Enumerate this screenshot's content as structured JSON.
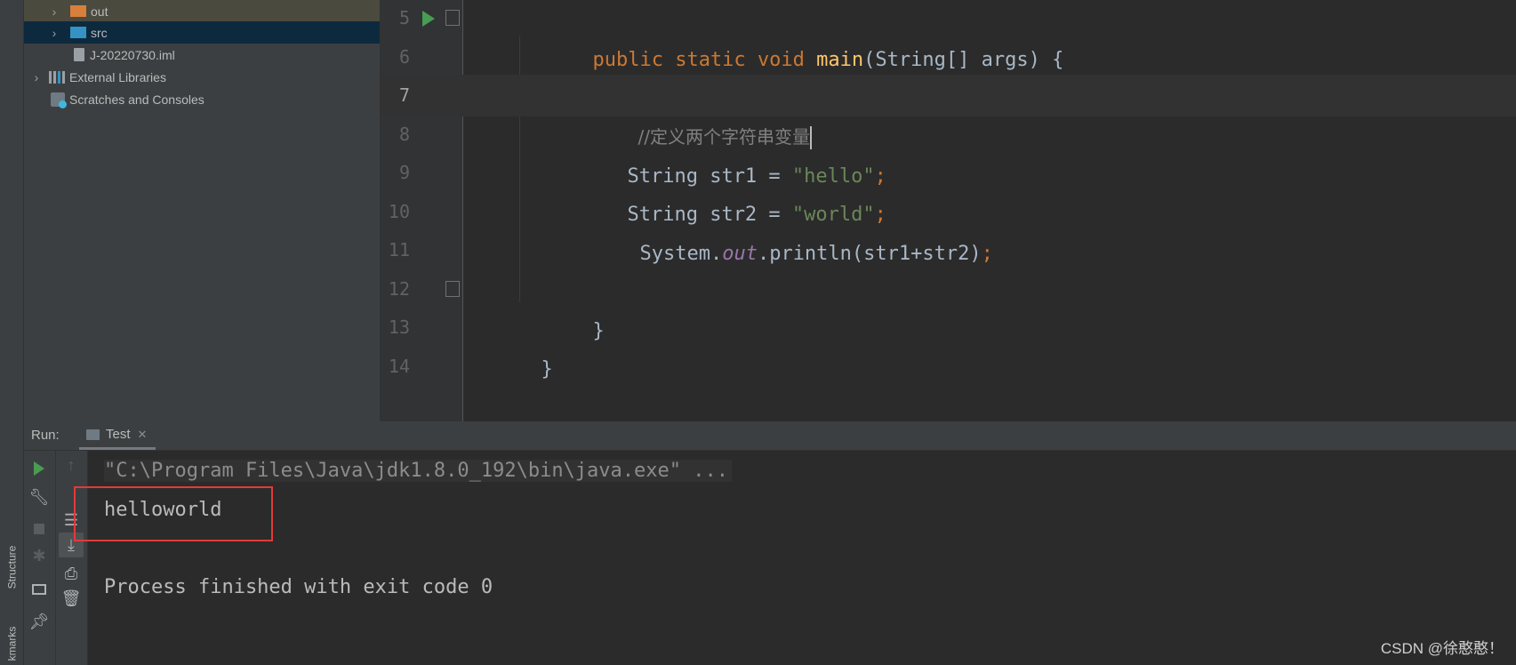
{
  "left_strip": {
    "tabs": [
      "Structure",
      "kmarks"
    ]
  },
  "project_tree": {
    "items": [
      {
        "label": "out",
        "icon": "folder-icon",
        "color": "#d97f3c",
        "state": "collapsed"
      },
      {
        "label": "src",
        "icon": "folder-icon",
        "color": "#3592c4",
        "state": "collapsed"
      },
      {
        "label": "J-20220730.iml",
        "icon": "iml-file-icon"
      },
      {
        "label": "External Libraries",
        "icon": "libraries-icon",
        "state": "collapsed"
      },
      {
        "label": "Scratches and Consoles",
        "icon": "scratches-icon"
      }
    ]
  },
  "editor": {
    "current_line": "7",
    "lines": [
      {
        "num": "5",
        "parts": [
          [
            "kw",
            "public static void "
          ],
          [
            "fn",
            "main"
          ],
          [
            "p",
            "(String[] args) {"
          ]
        ]
      },
      {
        "num": "6",
        "parts": []
      },
      {
        "num": "7",
        "parts": [
          [
            "cmt",
            "//定义两个字符串变量"
          ]
        ]
      },
      {
        "num": "8",
        "parts": [
          [
            "p",
            "String str1 = "
          ],
          [
            "str",
            "\"hello\""
          ],
          [
            "kw",
            ";"
          ]
        ]
      },
      {
        "num": "9",
        "parts": [
          [
            "p",
            "String str2 = "
          ],
          [
            "str",
            "\"world\""
          ],
          [
            "kw",
            ";"
          ]
        ]
      },
      {
        "num": "10",
        "parts": [
          [
            "p",
            "System."
          ],
          [
            "fld",
            "out"
          ],
          [
            "p",
            ".println(str1+str2)"
          ],
          [
            "kw",
            ";"
          ]
        ]
      },
      {
        "num": "11",
        "parts": []
      },
      {
        "num": "12",
        "parts": [
          [
            "p",
            "}"
          ]
        ]
      },
      {
        "num": "13",
        "parts": [
          [
            "p",
            "}"
          ]
        ]
      },
      {
        "num": "14",
        "parts": []
      }
    ]
  },
  "run": {
    "label": "Run:",
    "tab_label": "Test",
    "console_lines": [
      "\"C:\\Program Files\\Java\\jdk1.8.0_192\\bin\\java.exe\" ...",
      "helloworld",
      "",
      "Process finished with exit code 0"
    ]
  },
  "colors": {
    "keyword": "#cc7832",
    "function": "#ffc66d",
    "string": "#6a8759",
    "comment": "#808080",
    "field": "#9876aa",
    "highlight_box": "#e23a3a"
  },
  "watermark": "CSDN @徐憨憨！"
}
